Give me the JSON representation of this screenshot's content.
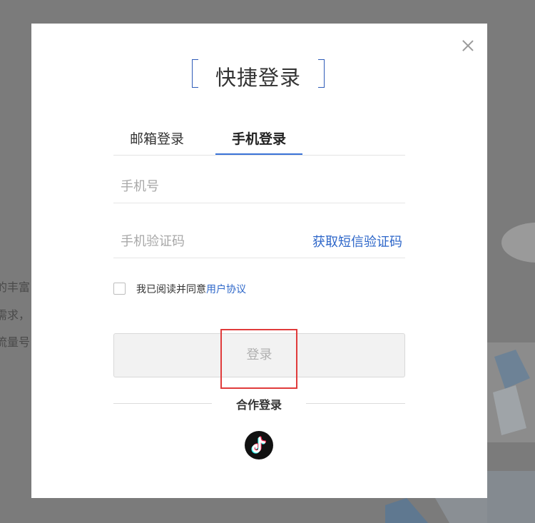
{
  "background": {
    "text_lines": [
      "的丰富",
      "需求，",
      "流量号"
    ]
  },
  "modal": {
    "title": "快捷登录",
    "tabs": [
      {
        "label": "邮箱登录",
        "active": false
      },
      {
        "label": "手机登录",
        "active": true
      }
    ],
    "phone_field": {
      "placeholder": "手机号",
      "value": ""
    },
    "code_field": {
      "placeholder": "手机验证码",
      "value": ""
    },
    "get_code_label": "获取短信验证码",
    "agreement": {
      "checked": false,
      "text": "我已阅读并同意",
      "link": "用户协议"
    },
    "login_button_label": "登录",
    "partner_login_label": "合作登录",
    "partner_icons": [
      "tiktok-icon"
    ],
    "colors": {
      "accent": "#2e67c9",
      "highlight": "#e03b3b"
    }
  }
}
